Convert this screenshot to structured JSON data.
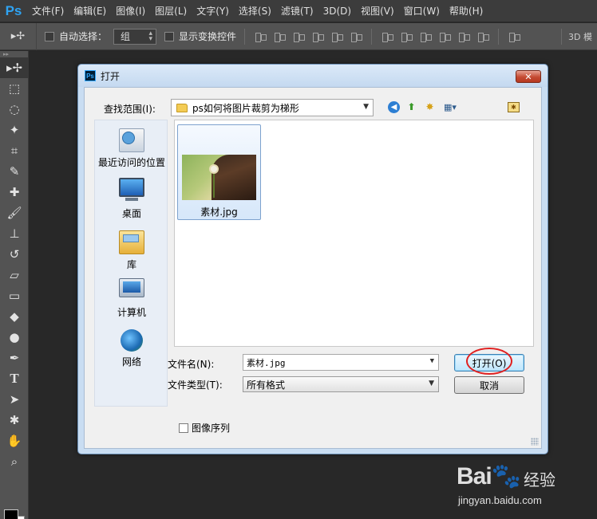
{
  "app": {
    "logo": "Ps",
    "menu": [
      "文件(F)",
      "编辑(E)",
      "图像(I)",
      "图层(L)",
      "文字(Y)",
      "选择(S)",
      "滤镜(T)",
      "3D(D)",
      "视图(V)",
      "窗口(W)",
      "帮助(H)"
    ]
  },
  "options": {
    "auto_select_label": "自动选择：",
    "auto_select_value": "组",
    "show_transform_label": "显示变换控件",
    "mode_3d": "3D 模"
  },
  "tools": [
    {
      "name": "move-tool-icon",
      "glyph": "▸✢"
    },
    {
      "name": "marquee-tool-icon",
      "glyph": "⬚"
    },
    {
      "name": "lasso-tool-icon",
      "glyph": "◌"
    },
    {
      "name": "magic-wand-tool-icon",
      "glyph": "✦"
    },
    {
      "name": "crop-tool-icon",
      "glyph": "⌗"
    },
    {
      "name": "eyedropper-tool-icon",
      "glyph": "✎"
    },
    {
      "name": "healing-brush-tool-icon",
      "glyph": "✚"
    },
    {
      "name": "brush-tool-icon",
      "glyph": "🖌"
    },
    {
      "name": "stamp-tool-icon",
      "glyph": "⊥"
    },
    {
      "name": "history-brush-tool-icon",
      "glyph": "↺"
    },
    {
      "name": "eraser-tool-icon",
      "glyph": "▱"
    },
    {
      "name": "gradient-tool-icon",
      "glyph": "▭"
    },
    {
      "name": "blur-tool-icon",
      "glyph": "◆"
    },
    {
      "name": "dodge-tool-icon",
      "glyph": "●"
    },
    {
      "name": "pen-tool-icon",
      "glyph": "✒"
    },
    {
      "name": "type-tool-icon",
      "glyph": "T"
    },
    {
      "name": "path-selection-tool-icon",
      "glyph": "➤"
    },
    {
      "name": "shape-tool-icon",
      "glyph": "✱"
    },
    {
      "name": "hand-tool-icon",
      "glyph": "✋"
    },
    {
      "name": "zoom-tool-icon",
      "glyph": "⌕"
    }
  ],
  "dialog": {
    "title_icon": "Ps",
    "title": "打开",
    "close_glyph": "✕",
    "look_in_label": "查找范围(I):",
    "look_in_value": "ps如何将图片裁剪为梯形",
    "places": [
      {
        "label": "最近访问的位置",
        "icon": "recent-places-icon"
      },
      {
        "label": "桌面",
        "icon": "desktop-icon"
      },
      {
        "label": "库",
        "icon": "libraries-icon"
      },
      {
        "label": "计算机",
        "icon": "computer-icon"
      },
      {
        "label": "网络",
        "icon": "network-icon"
      }
    ],
    "files": [
      {
        "name": "素材.jpg"
      }
    ],
    "file_name_label": "文件名(N):",
    "file_name_value": "素材.jpg",
    "file_type_label": "文件类型(T):",
    "file_type_value": "所有格式",
    "open_button": "打开(O)",
    "cancel_button": "取消",
    "image_sequence_label": "图像序列"
  },
  "watermark": {
    "brand": "Bai🐾",
    "brand_cn": "经验",
    "url": "jingyan.baidu.com"
  },
  "colors": {
    "ps_blue": "#2fa3f2",
    "dialog_frame": "#c9ddf2",
    "highlight_ring": "#e02020"
  }
}
